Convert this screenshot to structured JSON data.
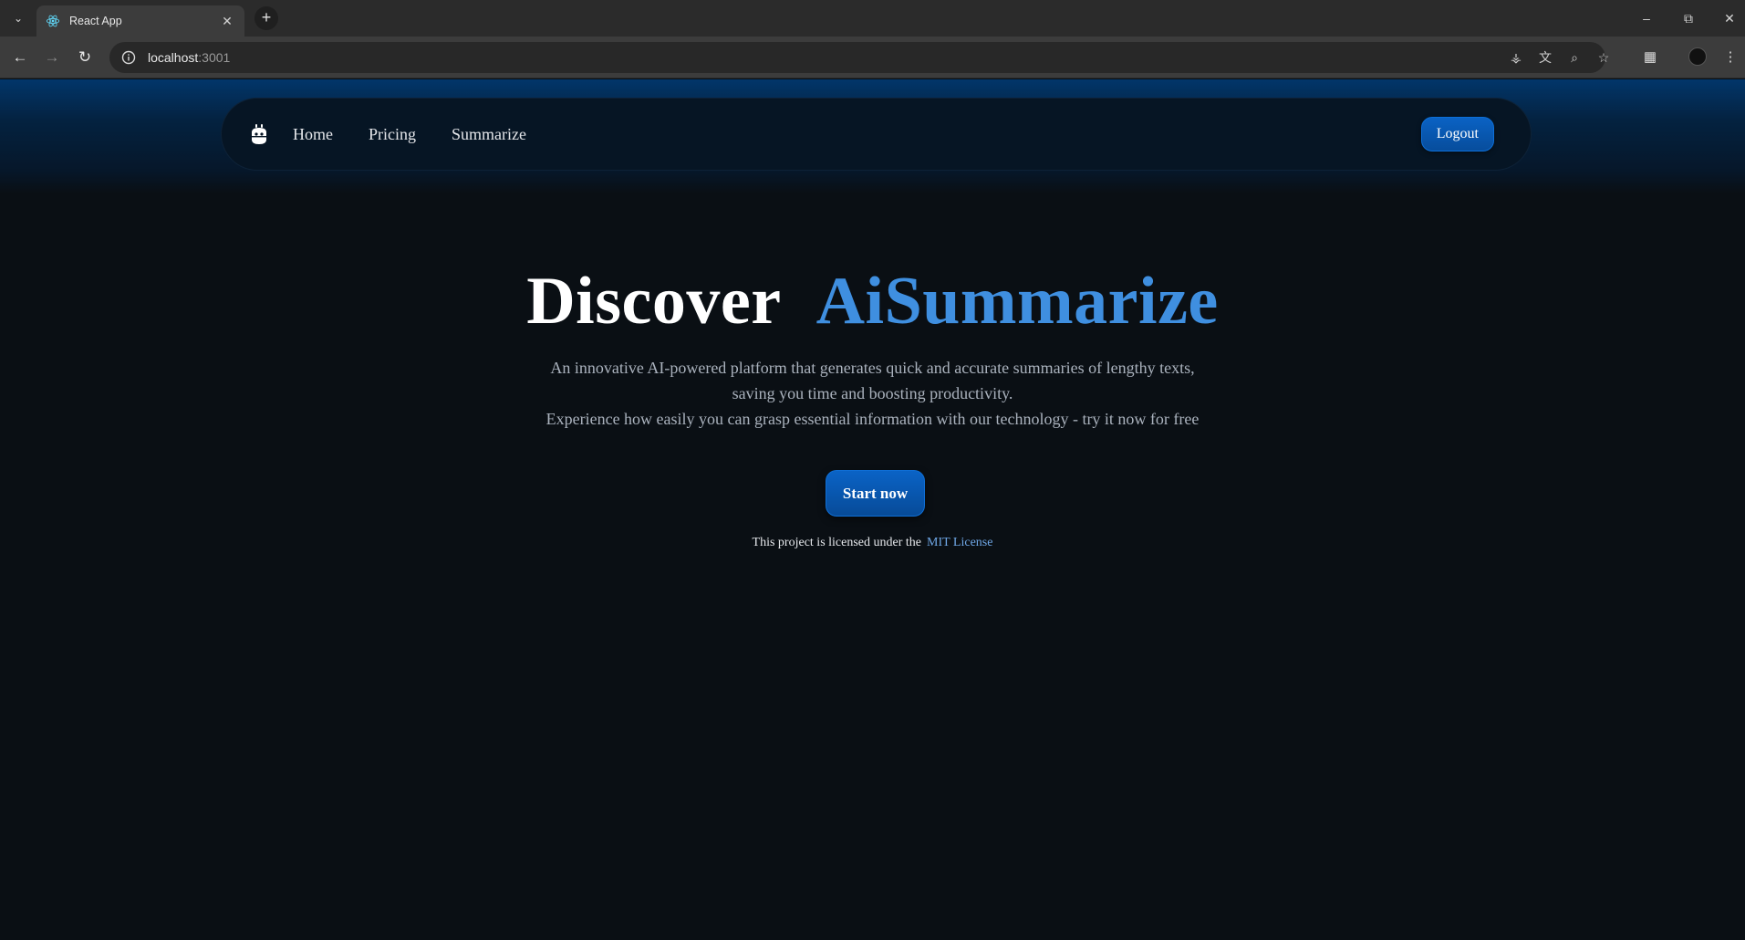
{
  "browser": {
    "tab_title": "React App",
    "url_host": "localhost",
    "url_port": ":3001"
  },
  "navbar": {
    "links": [
      "Home",
      "Pricing",
      "Summarize"
    ],
    "logout_label": "Logout"
  },
  "hero": {
    "title_part1": "Discover",
    "title_part2": "AiSummarize",
    "description_line1": "An innovative AI-powered platform that generates quick and accurate summaries of lengthy texts,",
    "description_line2": "saving you time and boosting productivity.",
    "description_line3": "Experience how easily you can grasp essential information with our technology - try it now for free",
    "cta_label": "Start now",
    "license_text": "This project is licensed under the",
    "license_link": "MIT License"
  },
  "colors": {
    "accent": "#3f8fe0",
    "button": "#0a5fbf",
    "background": "#0a0f14"
  },
  "icons": {
    "logo": "robot-head-icon"
  }
}
